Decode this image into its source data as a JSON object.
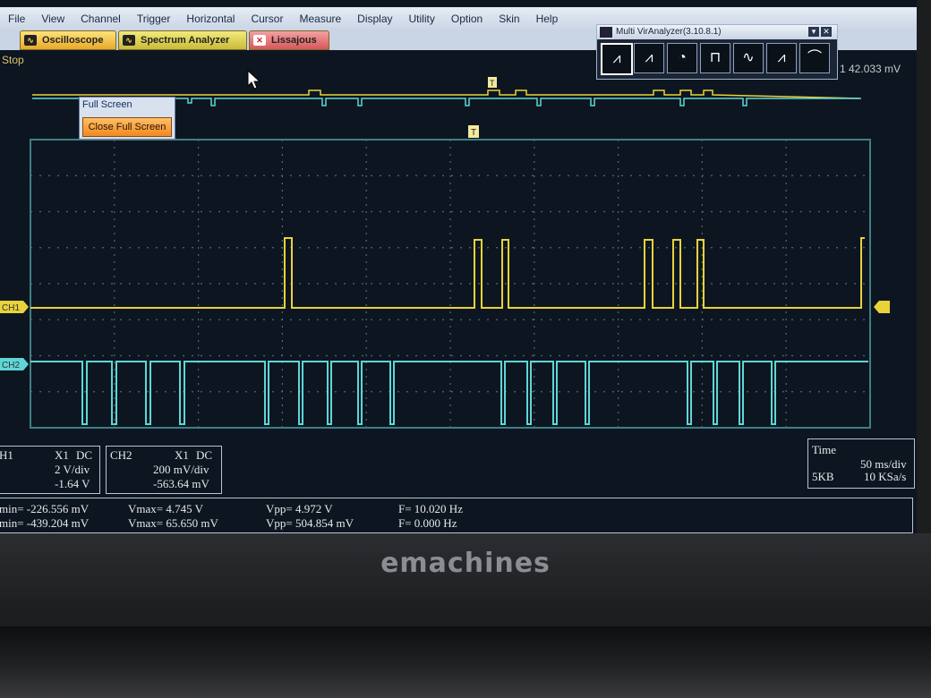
{
  "menu": [
    "File",
    "View",
    "Channel",
    "Trigger",
    "Horizontal",
    "Cursor",
    "Measure",
    "Display",
    "Utility",
    "Option",
    "Skin",
    "Help"
  ],
  "tabs": {
    "oscilloscope": "Oscilloscope",
    "spectrum": "Spectrum Analyzer",
    "lissajous": "Lissajous"
  },
  "status": {
    "run_state": "Stop",
    "right_readout": "1 42.033 mV"
  },
  "analyzer": {
    "title": "Multi VirAnalyzer(3.10.8.1)",
    "buttons": [
      "oscilloscope-mode",
      "spectrum-mode",
      "recorder-mode",
      "pulse-generator-mode",
      "dds-mode",
      "spectrum-history-mode",
      "filter-mode"
    ]
  },
  "popup": {
    "label": "Full Screen",
    "button": "Close Full Screen"
  },
  "channels": {
    "ch1": {
      "tag": "CH1",
      "probe": "X1",
      "coupling": "DC",
      "volts_div": "2 V/div",
      "offset": "-1.64 V",
      "color": "#e9d23a"
    },
    "ch2": {
      "tag": "CH2",
      "probe": "X1",
      "coupling": "DC",
      "volts_div": "200 mV/div",
      "offset": "-563.64 mV",
      "color": "#5fd6d6"
    }
  },
  "panel_labels": {
    "ch1": "H1",
    "ch2": "CH2"
  },
  "time": {
    "label": "Time",
    "time_div": "50 ms/div",
    "memory": "5KB",
    "sample_rate": "10 KSa/s"
  },
  "measurements": {
    "ch1": {
      "vmin": "min= -226.556 mV",
      "vmax": "Vmax= 4.745 V",
      "vpp": "Vpp= 4.972 V",
      "freq": "F= 10.020 Hz"
    },
    "ch2": {
      "vmin": "min= -439.204 mV",
      "vmax": "Vmax= 65.650 mV",
      "vpp": "Vpp= 504.854 mV",
      "freq": "F= 0.000 Hz"
    }
  },
  "trigger_marker": "T",
  "brand": "emachines",
  "colors": {
    "background": "#0d1620",
    "grid": "#4f6a78",
    "ch1": "#e9d23a",
    "ch2": "#5fd6d6",
    "tab_active": "#ffe27a"
  }
}
